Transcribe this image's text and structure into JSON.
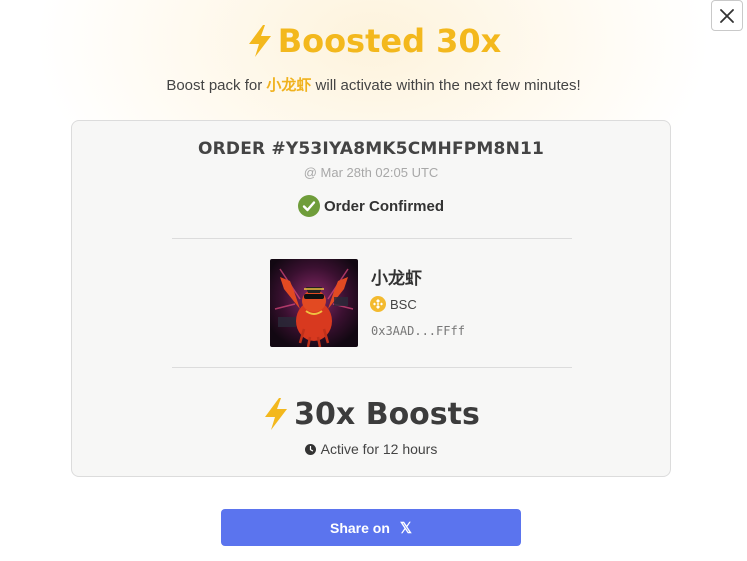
{
  "header": {
    "title": "Boosted 30x",
    "subtitle_pre": "Boost pack for ",
    "subtitle_token": "小龙虾",
    "subtitle_post": " will activate within the next few minutes!"
  },
  "order": {
    "id": "ORDER #Y53IYA8MK5CMHFPM8N11",
    "time": "@ Mar 28th 02:05 UTC",
    "status": "Order Confirmed"
  },
  "token": {
    "name": "小龙虾",
    "chain": "BSC",
    "address": "0x3AAD...FFff"
  },
  "boost": {
    "label": "30x Boosts",
    "duration": "Active for 12 hours"
  },
  "share": {
    "label": "Share on",
    "icon": "𝕏"
  },
  "colors": {
    "accent": "#f3b81d",
    "button": "#5b74ee",
    "confirmed": "#6f9d3a"
  }
}
